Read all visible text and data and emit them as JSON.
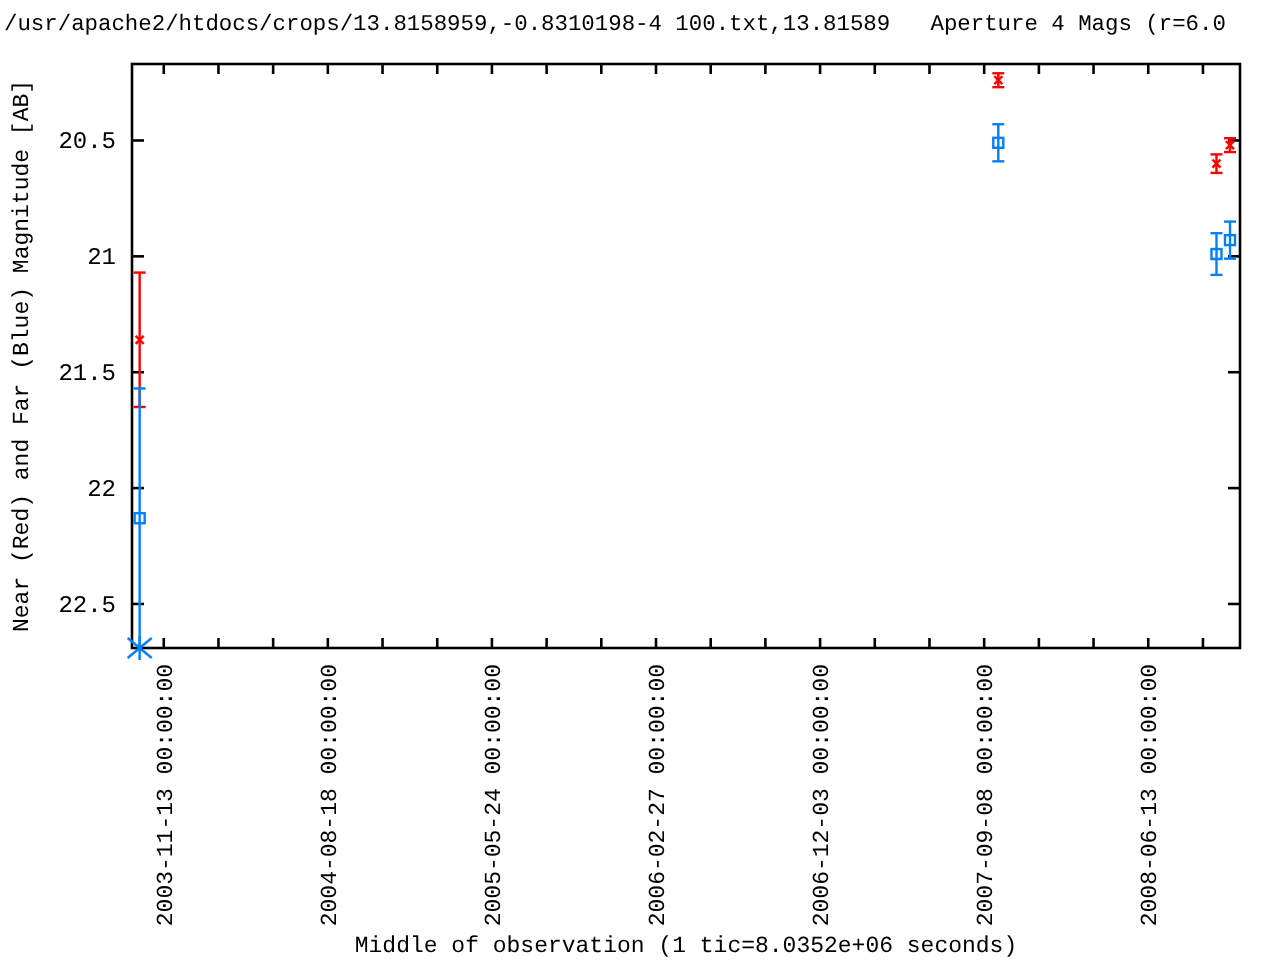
{
  "chart_data": {
    "type": "scatter",
    "title": "/usr/apache2/htdocs/crops/13.8158959,-0.8310198-4 100.txt,13.81589   Aperture 4 Mags (r=6.0",
    "xlabel": "Middle of observation (1 tic=8.0352e+06 seconds)",
    "ylabel": "Near (Red) and Far (Blue) Magnitude [AB]",
    "x": [
      "2003-10-03",
      "2007-10-02",
      "2008-10-07",
      "2008-10-30"
    ],
    "series": [
      {
        "color": "#ff0000",
        "values": [
          21.36,
          20.24,
          20.6,
          20.52
        ],
        "errors": [
          0.29,
          0.03,
          0.04,
          0.03
        ]
      },
      {
        "color": "#0080ff",
        "values": [
          22.13,
          20.51,
          20.99,
          20.93
        ],
        "errors": [
          0.56,
          0.08,
          0.09,
          0.08
        ]
      }
    ],
    "xlim": [
      "2003-09-20",
      "2008-11-16"
    ],
    "ylim": [
      22.69,
      20.17
    ],
    "xticks": [
      {
        "value": "2003-11-13",
        "label": "2003-11-13 00:00:00"
      },
      {
        "value": "2004-08-18",
        "label": "2004-08-18 00:00:00"
      },
      {
        "value": "2005-05-24",
        "label": "2005-05-24 00:00:00"
      },
      {
        "value": "2006-02-27",
        "label": "2006-02-27 00:00:00"
      },
      {
        "value": "2006-12-03",
        "label": "2006-12-03 00:00:00"
      },
      {
        "value": "2007-09-08",
        "label": "2007-09-08 00:00:00"
      },
      {
        "value": "2008-06-13",
        "label": "2008-06-13 00:00:00"
      }
    ],
    "yticks": [
      {
        "value": 20.5,
        "label": "20.5"
      },
      {
        "value": 21,
        "label": "21"
      },
      {
        "value": 21.5,
        "label": "21.5"
      },
      {
        "value": 22,
        "label": "22"
      },
      {
        "value": 22.5,
        "label": "22.5"
      }
    ]
  }
}
